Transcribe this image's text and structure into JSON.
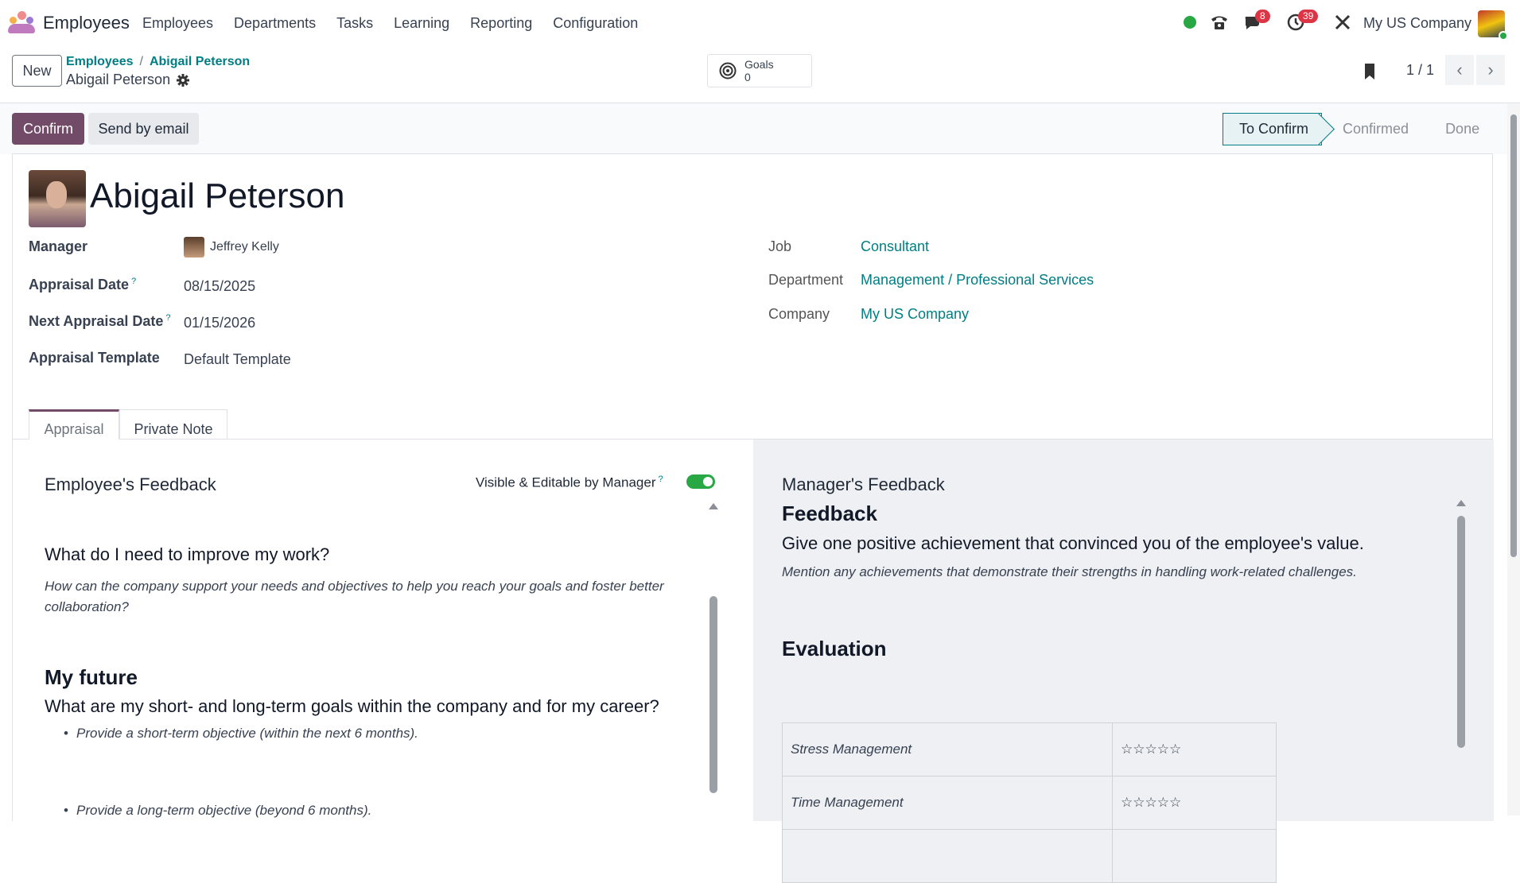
{
  "navbar": {
    "app_name": "Employees",
    "menu": [
      "Employees",
      "Departments",
      "Tasks",
      "Learning",
      "Reporting",
      "Configuration"
    ],
    "messages_badge": "8",
    "activities_badge": "39",
    "company": "My US Company",
    "colors": {
      "status_online": "#28a745",
      "badge": "#dc3545"
    }
  },
  "control_panel": {
    "new_label": "New",
    "breadcrumb": [
      "Employees",
      "Abigail Peterson"
    ],
    "record_title": "Abigail Peterson",
    "goals_label": "Goals",
    "goals_count": "0",
    "pager": "1 / 1"
  },
  "statusbar": {
    "confirm_label": "Confirm",
    "send_email_label": "Send by email",
    "stages": [
      "To Confirm",
      "Confirmed",
      "Done"
    ],
    "active_stage": "To Confirm",
    "colors": {
      "primary": "#714b67",
      "link": "#017e84"
    }
  },
  "form": {
    "employee_name": "Abigail Peterson",
    "left_fields": {
      "manager_label": "Manager",
      "manager_value": "Jeffrey Kelly",
      "appraisal_date_label": "Appraisal Date",
      "appraisal_date_value": "08/15/2025",
      "next_appraisal_label": "Next Appraisal Date",
      "next_appraisal_value": "01/15/2026",
      "template_label": "Appraisal Template",
      "template_value": "Default Template",
      "help_marker": "?"
    },
    "right_fields": {
      "job_label": "Job",
      "job_value": "Consultant",
      "department_label": "Department",
      "department_value": "Management / Professional Services",
      "company_label": "Company",
      "company_value": "My US Company"
    },
    "tabs": [
      "Appraisal",
      "Private Note"
    ]
  },
  "employee_feedback": {
    "title": "Employee's Feedback",
    "toggle_label": "Visible & Editable by Manager",
    "toggle_on": true,
    "q1_title": "What do I need to improve my work?",
    "q1_desc": "How can the company support your needs and objectives to help you reach your goals and foster better collaboration?",
    "section_title": "My future",
    "q2_title": "What are my short- and long-term goals within the company and for my career?",
    "bullets": [
      "Provide a short-term objective (within the next 6 months).",
      "Provide a long-term objective (beyond 6 months)."
    ]
  },
  "manager_feedback": {
    "title": "Manager's Feedback",
    "feedback_heading": "Feedback",
    "question": "Give one positive achievement that convinced you of the employee's value.",
    "hint": "Mention any achievements that demonstrate their strengths in handling work-related challenges.",
    "evaluation_heading": "Evaluation",
    "evaluation_rows": [
      {
        "criterion": "Stress Management",
        "stars": "☆☆☆☆☆"
      },
      {
        "criterion": "Time Management",
        "stars": "☆☆☆☆☆"
      }
    ]
  }
}
